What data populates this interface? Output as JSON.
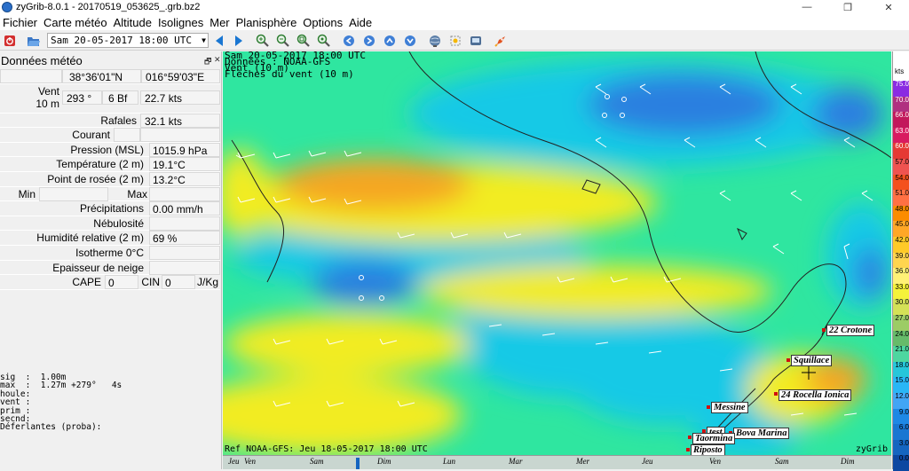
{
  "window": {
    "title": "zyGrib-8.0.1 - 20170519_053625_.grb.bz2",
    "min": "—",
    "max": "❐",
    "close": "✕"
  },
  "menu": [
    "Fichier",
    "Carte météo",
    "Altitude",
    "Isolignes",
    "Mer",
    "Planisphère",
    "Options",
    "Aide"
  ],
  "toolbar": {
    "date_value": "Sam 20-05-2017 18:00 UTC",
    "icons": [
      "power-icon",
      "open-file-icon",
      "arrow-left-icon",
      "arrow-right-icon",
      "zoom-in-icon",
      "zoom-out-icon",
      "zoom-area-icon",
      "zoom-fit-icon",
      "pan-left-icon",
      "pan-right-icon",
      "pan-up-icon",
      "pan-down-icon",
      "globe-icon",
      "selection-icon",
      "gauge-icon",
      "rocket-icon"
    ]
  },
  "panel": {
    "title": "Données météo",
    "float_btn": "🗗",
    "close_btn": "✕",
    "lat": "38°36'01\"N",
    "lon": "016°59'03\"E",
    "wind_label": "Vent",
    "wind_label2": "10 m",
    "wind_dir": "293 °",
    "wind_bf": "6 Bf",
    "wind_kts": "22.7  kts",
    "gust_label": "Rafales",
    "gust_val": "32.1  kts",
    "current_label": "Courant",
    "pressure_label": "Pression (MSL)",
    "pressure_val": "1015.9 hPa",
    "temp_label": "Température (2 m)",
    "temp_val": "19.1°C",
    "dew_label": "Point de rosée (2 m)",
    "dew_val": "13.2°C",
    "min_label": "Min",
    "max_label": "Max",
    "precip_label": "Précipitations",
    "precip_val": "0.00 mm/h",
    "cloud_label": "Nébulosité",
    "humid_label": "Humidité relative (2 m)",
    "humid_val": "69 %",
    "iso_label": "Isotherme 0°C",
    "snow_label": "Epaisseur de neige",
    "cape_label": "CAPE",
    "cape_val": "0",
    "cin_label": "CIN",
    "cin_val": "0",
    "cin_unit": "J/Kg"
  },
  "log": "sig  :  1.00m\nmax  :  1.27m +279°   4s\nhoule:\nvent :\nprim :\nsecnd:\nDéferlantes (proba):",
  "map": {
    "overlay_line1": "Sam 20-05-2017 18:00 UTC",
    "overlay_line2": "Données : NOAA-GFS",
    "overlay_line3": "Vent (10 m)",
    "overlay_line4": "Flèches du vent (10 m)",
    "ref": "Ref NOAA-GFS: Jeu 18-05-2017 18:00 UTC",
    "brand": "zyGrib",
    "cities": {
      "crotone": "22 Crotone",
      "squillace": "Squillace",
      "rocella": "24 Rocella Ionica",
      "messine": "Messine",
      "test": "test",
      "bova": "Bova Marina",
      "taormina": "Taormina",
      "riposto": "Riposto"
    }
  },
  "timeline": {
    "days": [
      "Jeu",
      "Ven",
      "Sam",
      "Dim",
      "Lun",
      "Mar",
      "Mer",
      "Jeu",
      "Ven",
      "Sam",
      "Dim"
    ]
  },
  "scale": {
    "unit": "kts",
    "labels": [
      "75.0",
      "70.0",
      "66.0",
      "63.0",
      "60.0",
      "57.0",
      "54.0",
      "51.0",
      "48.0",
      "45.0",
      "42.0",
      "39.0",
      "36.0",
      "33.0",
      "30.0",
      "27.0",
      "24.0",
      "21.0",
      "18.0",
      "15.0",
      "12.0",
      "9.0",
      "6.0",
      "3.0",
      "0.0"
    ]
  },
  "colors": {
    "calm": "#2b7fe0",
    "light": "#19c9e6",
    "moderate": "#2fe6a0",
    "fresh": "#f2ec22",
    "strong": "#f5a623"
  }
}
